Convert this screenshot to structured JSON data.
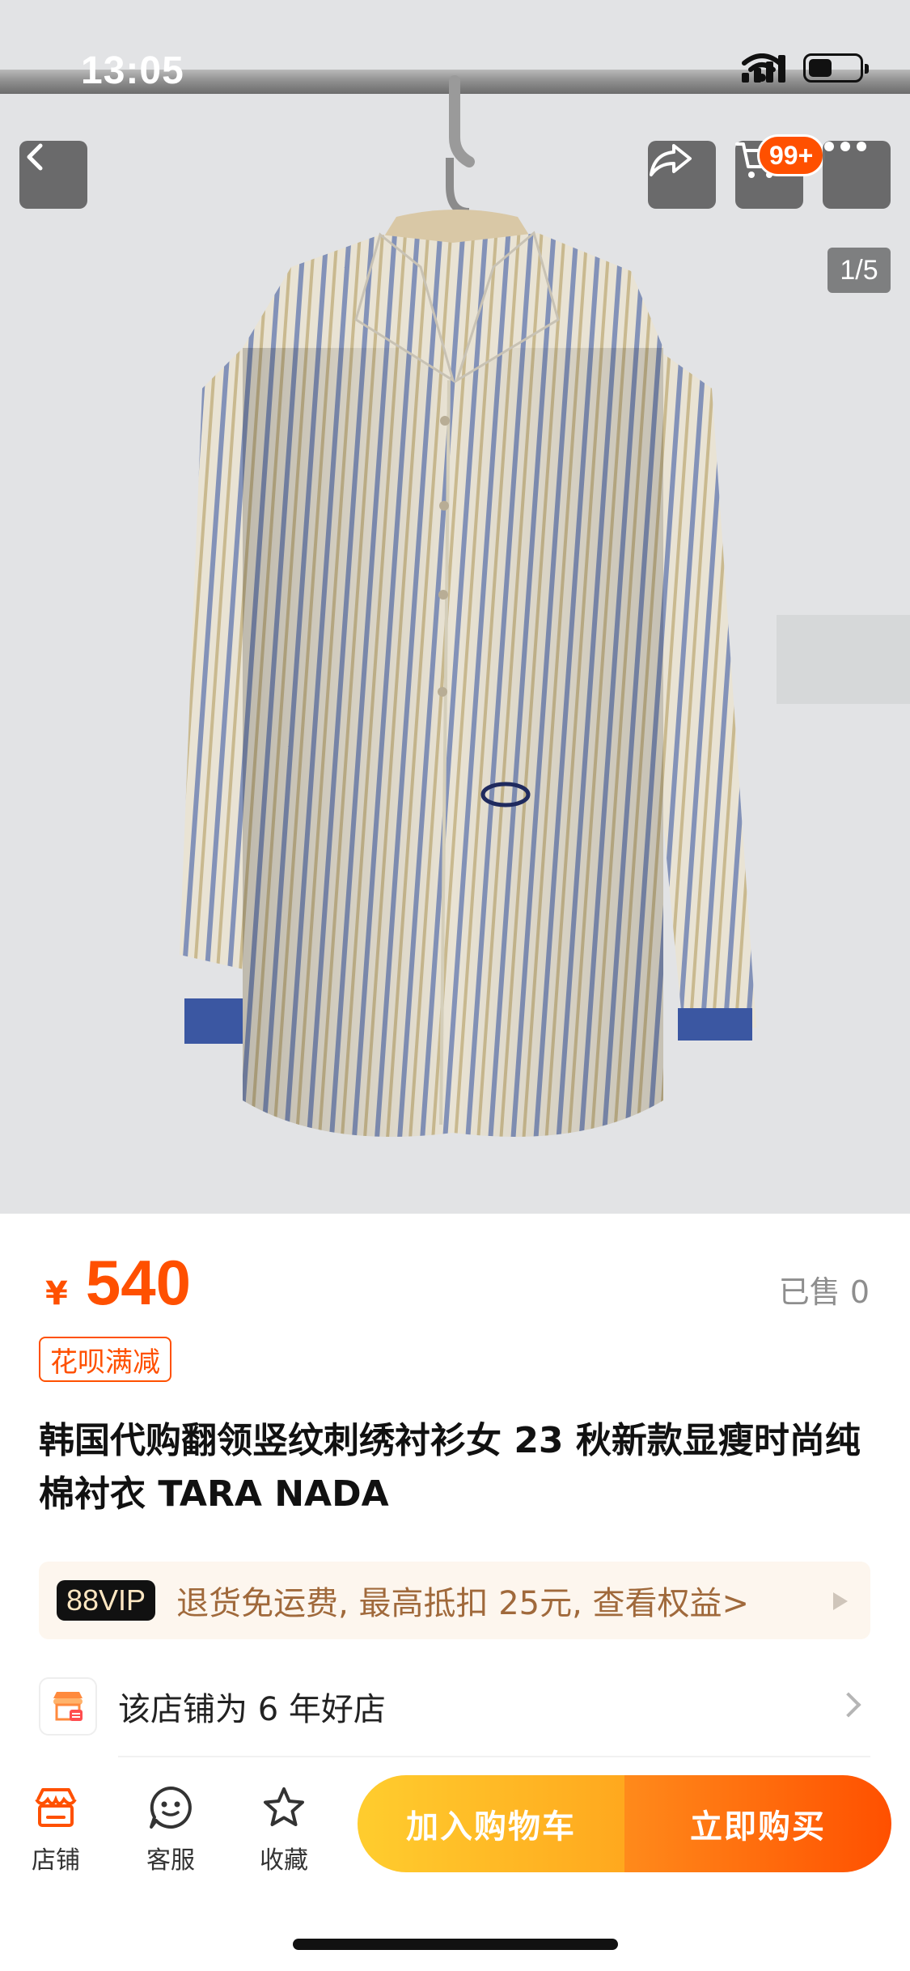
{
  "status_bar": {
    "time": "13:05"
  },
  "header": {
    "back_icon": "chevron-left-icon",
    "share_icon": "share-arrow-icon",
    "cart_icon": "cart-icon",
    "cart_badge": "99+",
    "more_icon": "more-dots-icon"
  },
  "gallery": {
    "page_indicator": "1/5"
  },
  "product": {
    "price_symbol": "¥",
    "price": "540",
    "sold": "已售 0",
    "promo_tag": "花呗满减",
    "title": "韩国代购翻领竖纹刺绣衬衫女 23 秋新款显瘦时尚纯棉衬衣 TARA NADA"
  },
  "vip": {
    "badge": "88VIP",
    "text": "退货免运费, 最高抵扣 25元, 查看权益>"
  },
  "store": {
    "text": "该店铺为 6 年好店"
  },
  "bottom_bar": {
    "tabs": [
      {
        "label": "店铺",
        "icon": "store-icon"
      },
      {
        "label": "客服",
        "icon": "chat-icon"
      },
      {
        "label": "收藏",
        "icon": "star-icon"
      }
    ],
    "add_to_cart": "加入购物车",
    "buy_now": "立即购买"
  },
  "colors": {
    "accent": "#ff5000",
    "cart_button": "#ffb020",
    "vip_text": "#a0693b"
  }
}
